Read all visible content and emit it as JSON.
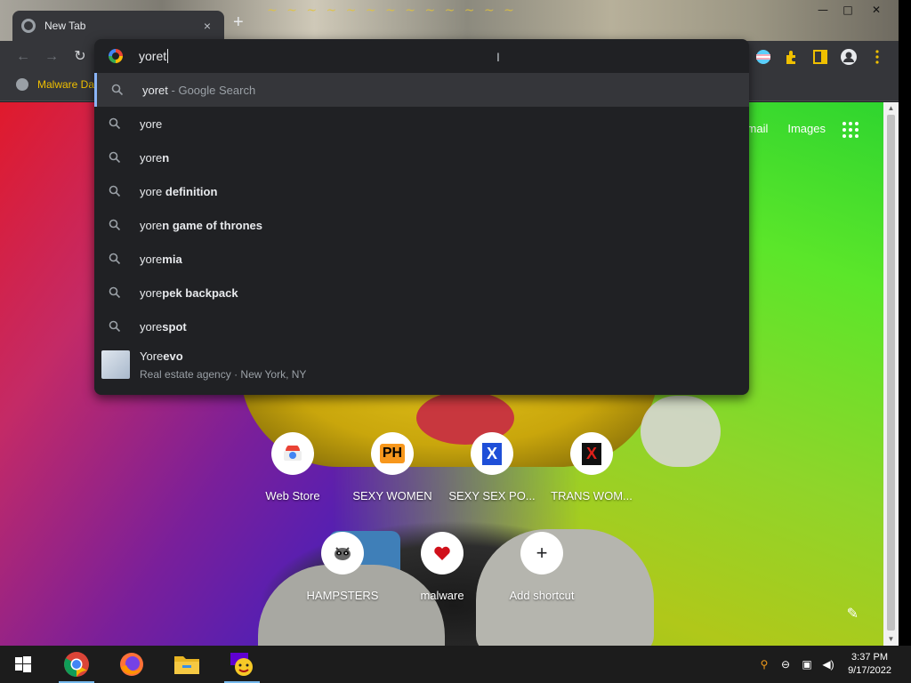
{
  "browser": {
    "tab_title": "New Tab",
    "tab_close": "×",
    "new_tab": "+",
    "window_controls": {
      "minimize": "—",
      "maximize": "□",
      "close": "✕"
    },
    "bookmarks": [
      {
        "label": "Malware Da"
      }
    ]
  },
  "omnibox": {
    "input_value": "yoret",
    "suggestions": [
      {
        "plain": "yoret",
        "bold": "",
        "hint": " - Google Search",
        "selected": true
      },
      {
        "plain": "yore",
        "bold": "",
        "hint": ""
      },
      {
        "plain": "yore",
        "bold": "n",
        "hint": ""
      },
      {
        "plain": "yore ",
        "bold": "definition",
        "hint": ""
      },
      {
        "plain": "yore",
        "bold": "n game of thrones",
        "hint": ""
      },
      {
        "plain": "yore",
        "bold": "mia",
        "hint": ""
      },
      {
        "plain": "yore",
        "bold": "pek backpack",
        "hint": ""
      },
      {
        "plain": "yore",
        "bold": "spot",
        "hint": ""
      }
    ],
    "entity": {
      "name_plain": "Yore",
      "name_bold": "evo",
      "description": "Real estate agency · New York, NY"
    }
  },
  "ntp": {
    "links": {
      "gmail": "mail",
      "images": "Images"
    },
    "shortcuts": [
      {
        "label": "Web Store",
        "icon": "webstore-icon"
      },
      {
        "label": "SEXY WOMEN",
        "icon": "ph-icon",
        "icon_text": "PH"
      },
      {
        "label": "SEXY SEX PO...",
        "icon": "x-blue-icon",
        "icon_text": "X"
      },
      {
        "label": "TRANS WOM...",
        "icon": "x-red-icon",
        "icon_text": "X"
      },
      {
        "label": "HAMPSTERS",
        "icon": "raccoon-icon"
      },
      {
        "label": "malware",
        "icon": "heart-icon"
      },
      {
        "label": "Add shortcut",
        "icon": "plus-icon",
        "icon_text": "+"
      }
    ]
  },
  "taskbar": {
    "time": "3:37 PM",
    "date": "9/17/2022"
  }
}
